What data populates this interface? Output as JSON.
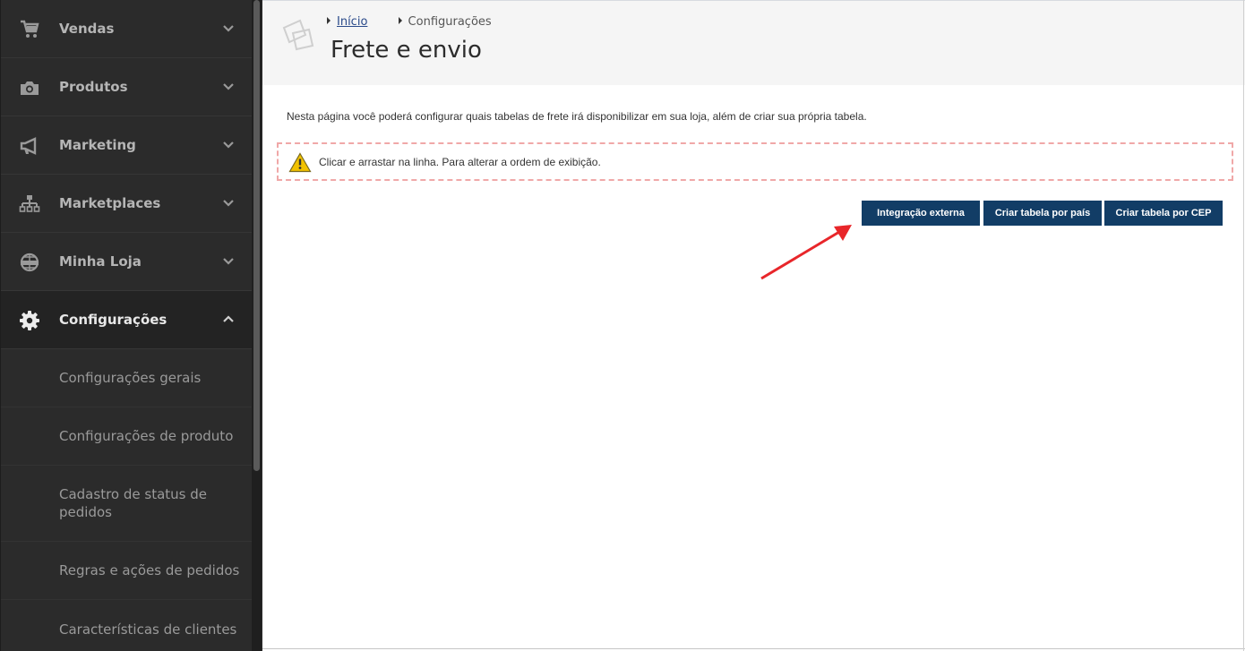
{
  "sidebar": {
    "menu": [
      {
        "label": "Vendas",
        "icon": "shopping-cart-icon"
      },
      {
        "label": "Produtos",
        "icon": "camera-icon"
      },
      {
        "label": "Marketing",
        "icon": "megaphone-icon"
      },
      {
        "label": "Marketplaces",
        "icon": "sitemap-icon"
      },
      {
        "label": "Minha Loja",
        "icon": "globe-www-icon"
      },
      {
        "label": "Configurações",
        "icon": "gear-icon"
      }
    ],
    "submenu": [
      {
        "label": "Configurações gerais"
      },
      {
        "label": "Configurações de produto"
      },
      {
        "label": "Cadastro de status de pedidos"
      },
      {
        "label": "Regras e ações de pedidos"
      },
      {
        "label": "Características de clientes"
      }
    ]
  },
  "header": {
    "breadcrumb": [
      "Início",
      "Configurações"
    ],
    "title": "Frete e envio"
  },
  "main": {
    "description": "Nesta página você poderá configurar quais tabelas de frete irá disponibilizar em sua loja, além de criar sua própria tabela.",
    "warning": "Clicar e arrastar na linha. Para alterar a ordem de exibição.",
    "buttons": [
      "Integração externa",
      "Criar tabela por país",
      "Criar tabela por CEP"
    ]
  },
  "colors": {
    "sidebar_bg": "#2b2b2b",
    "button_bg": "#123d66",
    "annotation_arrow": "#e8262a",
    "warning_border": "#f0a8a8"
  }
}
